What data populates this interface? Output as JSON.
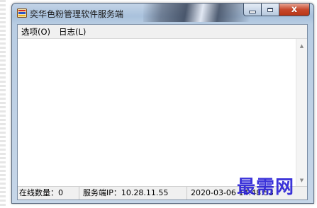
{
  "window": {
    "title": "奕华色粉管理软件服务端",
    "close_glyph": "x"
  },
  "menu": {
    "items": [
      {
        "label": "选项(O)"
      },
      {
        "label": "日志(L)"
      }
    ]
  },
  "log": {
    "content": ""
  },
  "status": {
    "online_count": "在线数量：0",
    "server_ip": "服务端IP：10.28.11.55",
    "datetime": "2020-03-06 14:48:53"
  },
  "watermark": {
    "text": "最需网"
  },
  "colors": {
    "close_button": "#c7482c",
    "watermark": "#2b22d6",
    "titlebar": "#b9cde3"
  }
}
